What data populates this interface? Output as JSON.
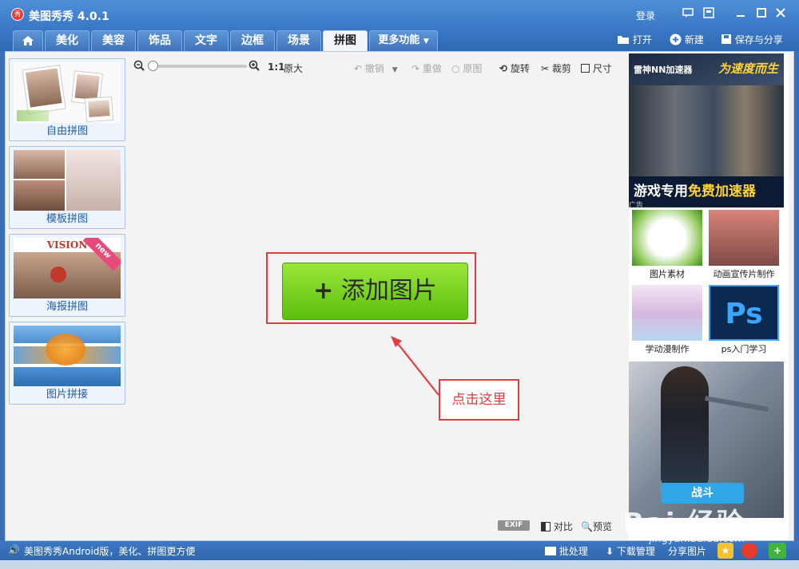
{
  "app": {
    "title": "美图秀秀 4.0.1",
    "login": "登录"
  },
  "window_controls": [
    "comment-icon",
    "skin-icon",
    "minimize-icon",
    "maximize-icon",
    "close-icon"
  ],
  "tabs": [
    "美化",
    "美容",
    "饰品",
    "文字",
    "边框",
    "场景",
    "拼图",
    "更多功能"
  ],
  "active_tab": "拼图",
  "top_actions": {
    "open": "打开",
    "new": "新建",
    "save_share": "保存与分享"
  },
  "left_panel": {
    "items": [
      {
        "label": "自由拼图"
      },
      {
        "label": "模板拼图"
      },
      {
        "label": "海报拼图",
        "badge": "new",
        "thumb_text": "VISION"
      },
      {
        "label": "图片拼接"
      }
    ]
  },
  "toolbar": {
    "ratio": "1:1",
    "original_size": "原大",
    "undo": "撤销",
    "redo": "重做",
    "original": "原图",
    "rotate": "旋转",
    "crop": "裁剪",
    "size": "尺寸",
    "zoom_level": 0
  },
  "canvas": {
    "add_button": "添加图片",
    "hint": "点击这里"
  },
  "bottom_tools": {
    "exif": "EXIF",
    "compare": "对比",
    "preview": "预览"
  },
  "right_panel": {
    "top_ad": {
      "brand": "雷神NN加速器",
      "slogan": "为速度而生",
      "band_prefix": "游戏专用",
      "band_highlight": "免费加速器",
      "tag": "广告"
    },
    "tiles": [
      {
        "caption": "图片素材"
      },
      {
        "caption": "动画宣传片制作"
      },
      {
        "caption": "学动漫制作"
      },
      {
        "caption": "ps入门学习"
      }
    ],
    "bottom_ad": {
      "button": "战斗"
    }
  },
  "status_bar": {
    "message": "美图秀秀Android版，美化、拼图更方便",
    "batch": "批处理",
    "download": "下载管理",
    "share": "分享图片"
  },
  "watermark": {
    "text": "Bai 经验",
    "url": "jingyan.baidu.com"
  },
  "colors": {
    "accent": "#3a78c6",
    "add_button": "#7fd625",
    "highlight": "#e53b3b"
  }
}
